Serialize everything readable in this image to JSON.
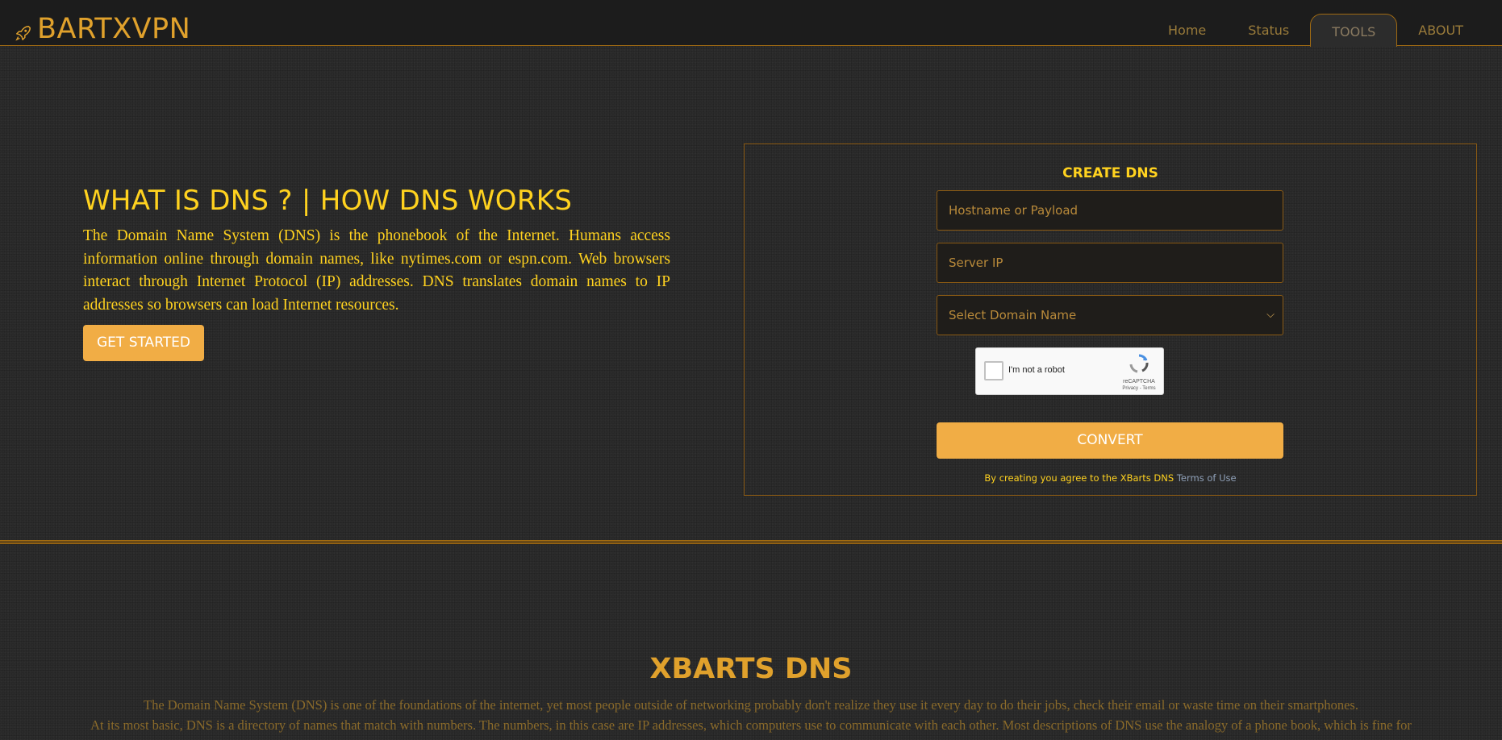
{
  "brand": {
    "name": "BARTXVPN",
    "icon": "rocket-icon"
  },
  "nav": {
    "items": [
      {
        "label": "Home",
        "active": false
      },
      {
        "label": "Status",
        "active": false
      },
      {
        "label": "TOOLS",
        "active": true
      },
      {
        "label": "ABOUT",
        "active": false
      }
    ]
  },
  "hero": {
    "title": "WHAT IS DNS ? | HOW DNS WORKS",
    "description": "The Domain Name System (DNS) is the phonebook of the Internet. Humans access information online through domain names, like nytimes.com or espn.com. Web browsers interact through Internet Protocol (IP) addresses. DNS translates domain names to IP addresses so browsers can load Internet resources.",
    "button_label": "GET STARTED"
  },
  "form": {
    "title": "CREATE DNS",
    "hostname_placeholder": "Hostname or Payload",
    "server_ip_placeholder": "Server IP",
    "domain_select": {
      "selected": "Select Domain Name"
    },
    "captcha": {
      "label": "I'm not a robot",
      "brand": "reCAPTCHA",
      "links": "Privacy - Terms"
    },
    "submit_label": "CONVERT",
    "agreement_text": "By creating you agree to the XBarts DNS ",
    "terms_link": "Terms of Use"
  },
  "section": {
    "title": "XBARTS DNS",
    "line1": "The Domain Name System (DNS) is one of the foundations of the internet, yet most people outside of networking probably don't realize they use it every day to do their jobs, check their email or waste time on their smartphones.",
    "line2": "At its most basic, DNS is a directory of names that match with numbers. The numbers, in this case are IP addresses, which computers use to communicate with each other. Most descriptions of DNS use the analogy of a phone book, which is fine for"
  },
  "colors": {
    "accent": "#f1ad45",
    "brand": "#e0a12c",
    "heading": "#ffd21f",
    "background": "#2b2b2b",
    "topbar": "#1c1c1c"
  }
}
